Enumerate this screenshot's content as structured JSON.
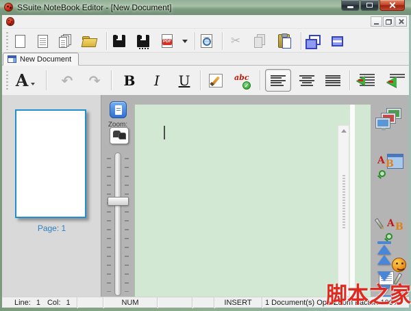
{
  "window": {
    "title": "SSuite NoteBook Editor - [New Document]"
  },
  "tab": {
    "label": "New Document"
  },
  "toolbar": {
    "pdf_label": "PDF",
    "icons": [
      "new-document-icon",
      "document-template-icon",
      "copy-documents-icon",
      "open-folder-icon",
      "save-icon",
      "save-as-icon",
      "export-pdf-icon",
      "dropdown-arrow-icon",
      "print-preview-icon",
      "cut-icon",
      "copy-icon",
      "paste-icon",
      "cascade-windows-icon",
      "tile-windows-icon"
    ],
    "cut_glyph": "✂"
  },
  "format_toolbar": {
    "font_letter": "A",
    "undo_glyph": "↶",
    "redo_glyph": "↷",
    "bold": "B",
    "italic": "I",
    "underline": "U",
    "spell_text": "abc",
    "spell_check_glyph": "✓",
    "icons": [
      "font-select-icon",
      "undo-icon",
      "redo-icon",
      "bold-icon",
      "italic-icon",
      "underline-icon",
      "format-painter-icon",
      "spell-check-icon",
      "align-left-icon",
      "align-center-icon",
      "align-justify-icon",
      "decrease-indent-icon",
      "remove-indent-icon"
    ],
    "align_selected": "align-left"
  },
  "thumbnail_panel": {
    "page_label": "Page: 1"
  },
  "zoom_panel": {
    "label": "Zoom:",
    "value": "100%"
  },
  "right_sidebar": {
    "icons": [
      "monitors-view-icon",
      "find-icon",
      "find-replace-icon",
      "edit-note-icon",
      "go-to-top-icon",
      "page-up-icon",
      "smiley-icon",
      "page-down-icon",
      "go-to-bottom-icon"
    ]
  },
  "status_bar": {
    "line_label": "Line:",
    "line_value": "1",
    "col_label": "Col:",
    "col_value": "1",
    "num": "NUM",
    "insert": "INSERT",
    "documents_open": "1 Document(s) Open",
    "zoom_factor": "Zoom Factor: 100%"
  },
  "watermark": "脚本之家",
  "colors": {
    "titlebar_green": "#7e9d81",
    "editor_green": "#d2e8d2",
    "page_border_blue": "#1e8fd0",
    "page_label_blue": "#2f7fc1",
    "watermark_red": "#dd2b22",
    "pdf_red": "#d93025",
    "nav_blue": "#4a86d8"
  }
}
